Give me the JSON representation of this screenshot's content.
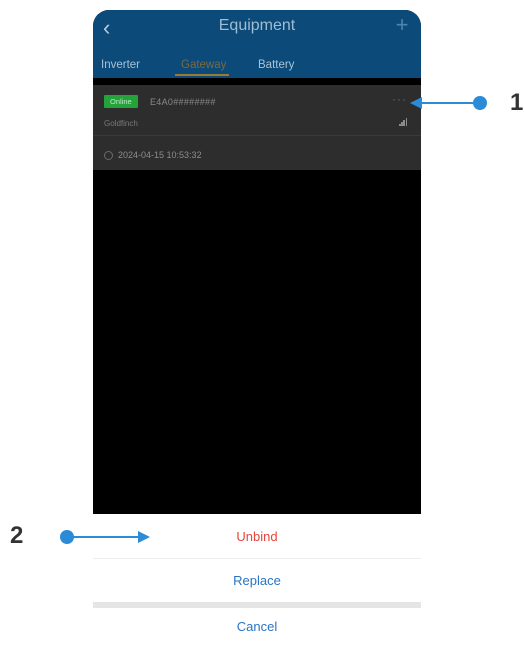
{
  "header": {
    "title": "Equipment",
    "back_icon": "chevron-left-icon",
    "add_icon": "plus-icon"
  },
  "tabs": [
    {
      "label": "Inverter",
      "active": false
    },
    {
      "label": "Gateway",
      "active": true
    },
    {
      "label": "Battery",
      "active": false
    }
  ],
  "device": {
    "status": "Online",
    "serial": "E4A0########",
    "model": "Goldfinch",
    "timestamp": "2024-04-15 10:53:32",
    "more_icon": "ellipsis-icon",
    "signal_icon": "signal-bars-icon",
    "clock_icon": "clock-icon"
  },
  "action_sheet": {
    "unbind_label": "Unbind",
    "replace_label": "Replace",
    "cancel_label": "Cancel"
  },
  "callouts": {
    "one": "1",
    "two": "2"
  },
  "colors": {
    "header_bg": "#0b4a79",
    "online_badge": "#24a33a",
    "destructive": "#e6443d",
    "action": "#2b74c4",
    "callout": "#2b8bd6"
  }
}
